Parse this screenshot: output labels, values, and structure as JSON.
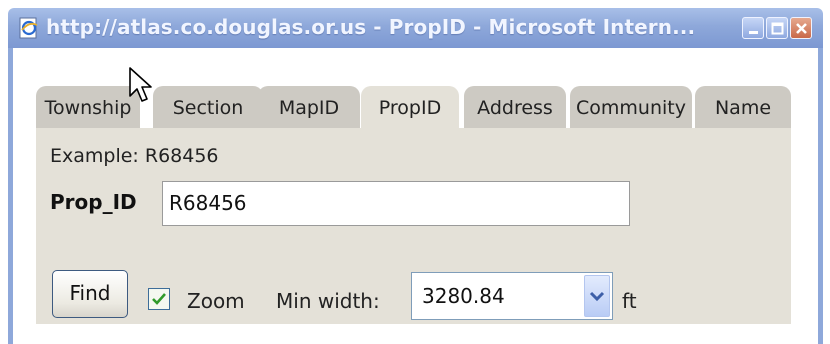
{
  "window": {
    "title": "http://atlas.co.douglas.or.us - PropID - Microsoft Intern...",
    "title_color": "#f1f5ff",
    "titlebar_color": "#8ea8da"
  },
  "tabs": [
    {
      "label": "Township",
      "active": false
    },
    {
      "label": "Section",
      "active": false
    },
    {
      "label": "MapID",
      "active": false
    },
    {
      "label": "PropID",
      "active": true
    },
    {
      "label": "Address",
      "active": false
    },
    {
      "label": "Community",
      "active": false
    },
    {
      "label": "Name",
      "active": false
    }
  ],
  "form": {
    "example": "Example: R68456",
    "prop_label": "Prop_ID",
    "prop_value": "R68456",
    "find_label": "Find",
    "zoom_label": "Zoom",
    "zoom_checked": true,
    "min_width_label": "Min width:",
    "min_width_value": "3280.84",
    "unit": "ft"
  },
  "colors": {
    "panel_bg": "#e4e1d8",
    "tab_bg": "#cdcac3",
    "checkmark": "#2f9a2a"
  },
  "icons": {
    "window": "ie-page-icon",
    "minimize": "minimize-icon",
    "maximize": "maximize-icon",
    "close": "close-icon",
    "dropdown": "chevron-down-icon",
    "cursor": "mouse-cursor-icon"
  }
}
